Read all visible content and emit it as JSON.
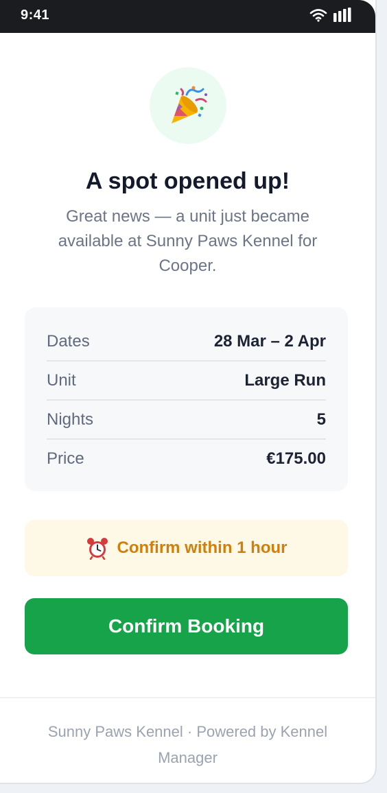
{
  "status_bar": {
    "time": "9:41",
    "wifi_icon": "wifi-icon",
    "signal_icon": "signal-bars-icon"
  },
  "hero": {
    "icon": "party-popper-icon",
    "title": "A spot opened up!",
    "subtitle": "Great news — a unit just became available at Sunny Paws Kennel for Cooper."
  },
  "details": [
    {
      "label": "Dates",
      "value": "28 Mar – 2 Apr"
    },
    {
      "label": "Unit",
      "value": "Large Run"
    },
    {
      "label": "Nights",
      "value": "5"
    },
    {
      "label": "Price",
      "value": "€175.00"
    }
  ],
  "alert": {
    "icon": "alarm-clock-icon",
    "text": "Confirm within 1 hour"
  },
  "actions": {
    "confirm_label": "Confirm Booking"
  },
  "footer": {
    "text": "Sunny Paws Kennel · Powered by Kennel Manager"
  },
  "colors": {
    "primary_green": "#17a34a",
    "alert_bg": "#fef8e6",
    "alert_text": "#d27f0a",
    "title_text": "#121a2b"
  }
}
